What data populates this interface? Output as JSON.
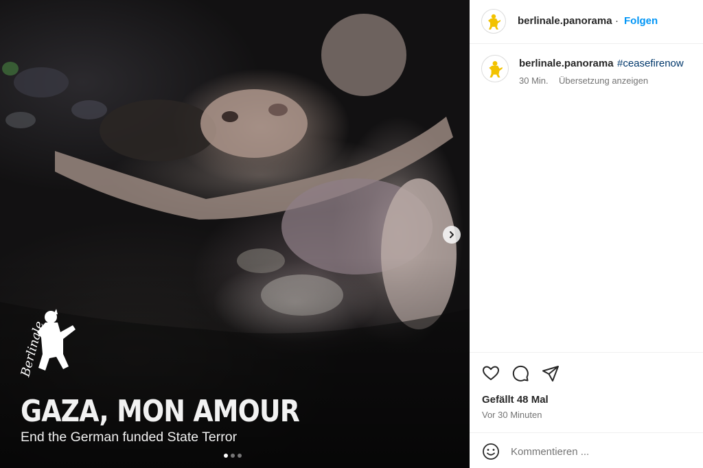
{
  "media": {
    "logo_text": "Berlinale",
    "title": "GAZA, MON AMOUR",
    "subtitle": "End the German funded State Terror",
    "carousel": {
      "count": 3,
      "active_index": 0
    },
    "next_icon": "chevron-right-icon"
  },
  "header": {
    "username": "berlinale.panorama",
    "separator": "·",
    "follow_label": "Folgen",
    "avatar_icon": "berlinale-bear-logo"
  },
  "caption": {
    "username": "berlinale.panorama",
    "hashtag": "#ceasefirenow",
    "time": "30 Min.",
    "translate_label": "Übersetzung anzeigen"
  },
  "actions": {
    "like_icon": "heart-icon",
    "comment_icon": "comment-icon",
    "share_icon": "share-icon",
    "likes_text": "Gefällt 48 Mal",
    "posted_text": "Vor 30 Minuten"
  },
  "comment": {
    "emoji_icon": "smiley-icon",
    "placeholder": "Kommentieren ..."
  },
  "colors": {
    "link_blue": "#0095f6",
    "hashtag_blue": "#00376b",
    "muted_text": "#737373",
    "bear_yellow": "#f2c200"
  }
}
